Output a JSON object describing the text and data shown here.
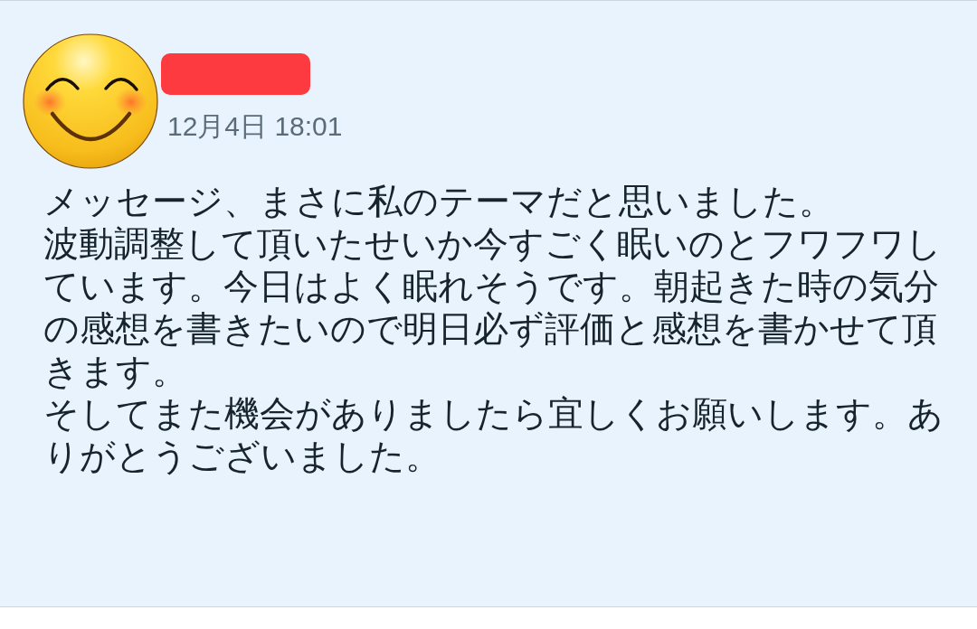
{
  "message": {
    "author": {
      "name_redacted": true
    },
    "timestamp": "12月4日 18:01",
    "paragraphs": [
      "メッセージ、まさに私のテーマだと思いました。",
      "波動調整して頂いたせいか今すごく眠いのとフワフワしています。今日はよく眠れそうです。朝起きた時の気分の感想を書きたいので明日必ず評価と感想を書かせて頂きます。",
      "そしてまた機会がありましたら宜しくお願いします。ありがとうございました。"
    ]
  }
}
